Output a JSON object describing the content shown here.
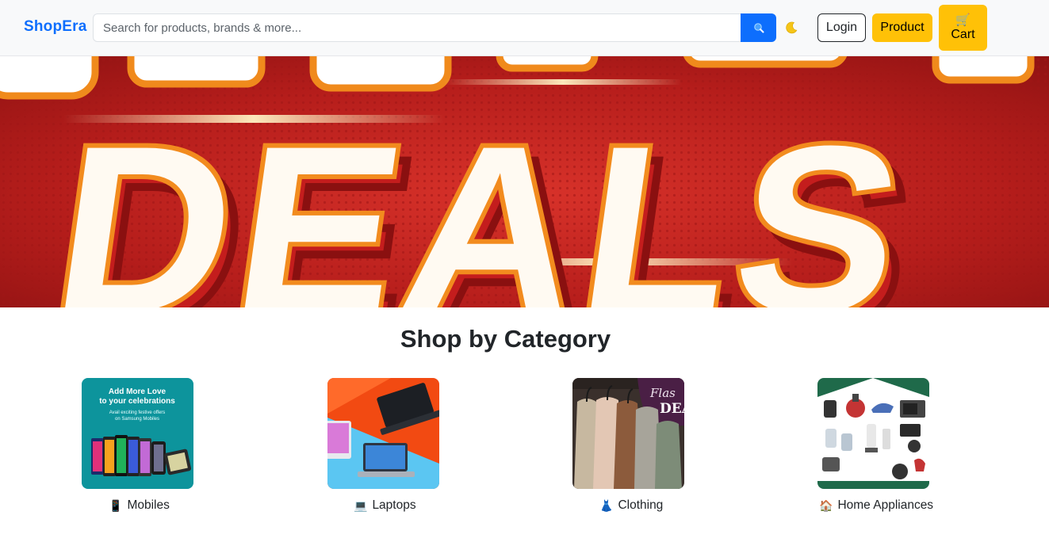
{
  "navbar": {
    "brand": "ShopEra",
    "search_placeholder": "Search for products, brands & more...",
    "search_icon": "search-icon",
    "theme_icon": "moon-icon",
    "login_label": "Login",
    "product_label": "Product",
    "cart_icon": "🛒",
    "cart_label": "Cart"
  },
  "hero": {
    "banner_text": "DEALS"
  },
  "categories": {
    "title": "Shop by Category",
    "items": [
      {
        "emoji": "📱",
        "label": "Mobiles",
        "promo_line1": "Add More Love",
        "promo_line2": "to your celebrations",
        "promo_line3": "Avail exciting festive offers",
        "promo_line4": "on Samsung Mobiles"
      },
      {
        "emoji": "💻",
        "label": "Laptops"
      },
      {
        "emoji": "👗",
        "label": "Clothing",
        "promo": "Flas DEA"
      },
      {
        "emoji": "🏠",
        "label": "Home Appliances"
      }
    ]
  },
  "colors": {
    "brand": "#0d6efd",
    "accent": "#ffc107",
    "navbar_bg": "#f8f9fa",
    "text": "#212529"
  }
}
